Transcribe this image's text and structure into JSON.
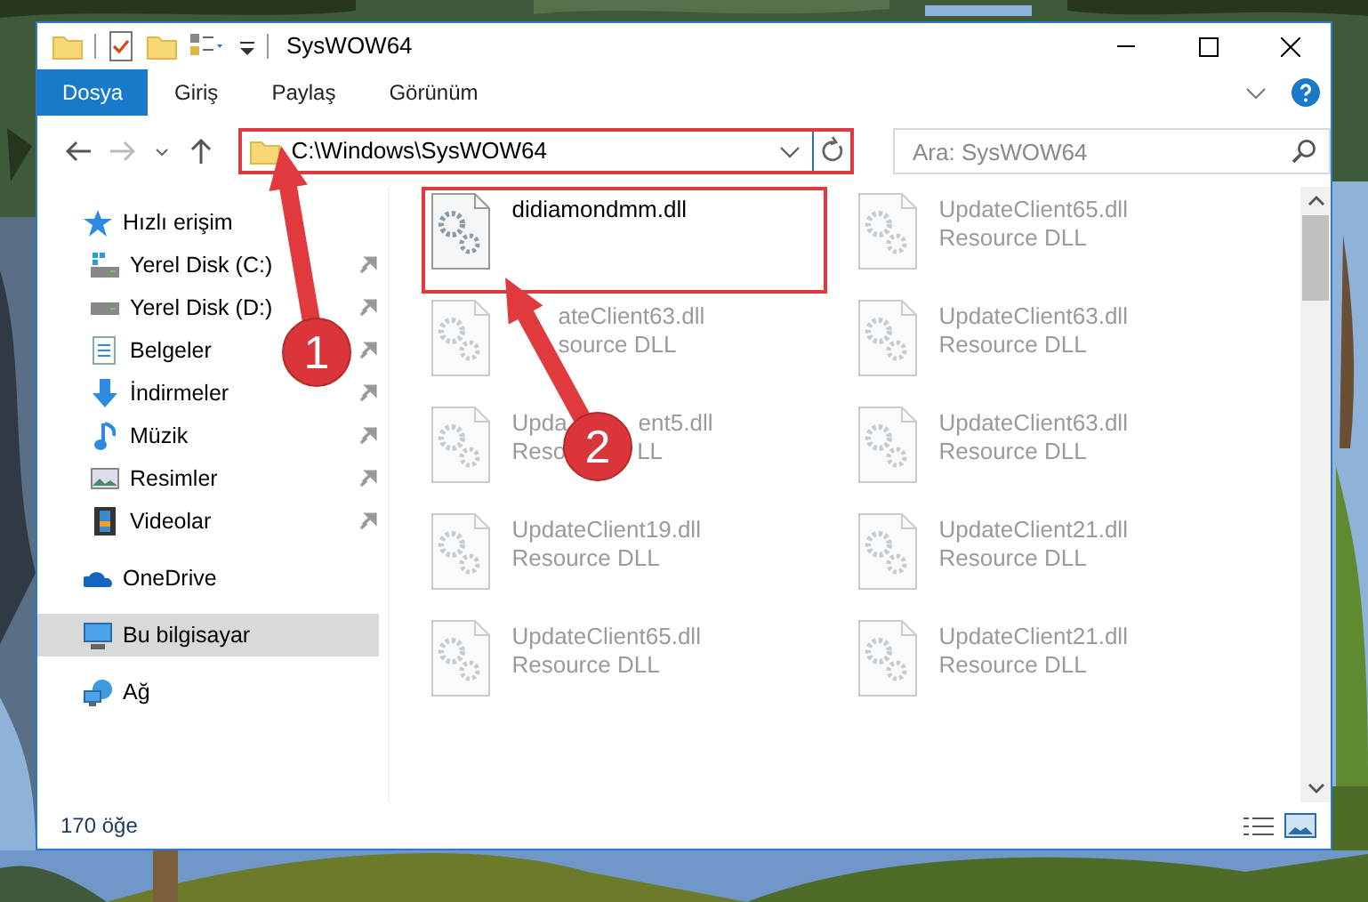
{
  "window": {
    "title": "SysWOW64"
  },
  "ribbon": {
    "tabs": [
      {
        "label": "Dosya",
        "kind": "file",
        "selected": false
      },
      {
        "label": "Giriş",
        "kind": "tab",
        "selected": false
      },
      {
        "label": "Paylaş",
        "kind": "tab",
        "selected": false
      },
      {
        "label": "Görünüm",
        "kind": "tab",
        "selected": false
      }
    ]
  },
  "address": {
    "path": "C:\\Windows\\SysWOW64",
    "highlighted": true
  },
  "search": {
    "placeholder": "Ara: SysWOW64"
  },
  "navigation": [
    {
      "label": "Hızlı erişim",
      "kind": "star",
      "selected": false,
      "children": [
        {
          "label": "Yerel Disk (C:)",
          "kind": "system-drive",
          "pinned": true,
          "selected": false
        },
        {
          "label": "Yerel Disk (D:)",
          "kind": "drive",
          "pinned": true,
          "selected": false
        },
        {
          "label": "Belgeler",
          "kind": "documents",
          "pinned": true,
          "selected": false
        },
        {
          "label": "İndirmeler",
          "kind": "download",
          "pinned": true,
          "selected": false
        },
        {
          "label": "Müzik",
          "kind": "music",
          "pinned": true,
          "selected": false
        },
        {
          "label": "Resimler",
          "kind": "pictures",
          "pinned": true,
          "selected": false
        },
        {
          "label": "Videolar",
          "kind": "video",
          "pinned": true,
          "selected": false
        }
      ]
    },
    {
      "label": "OneDrive",
      "kind": "cloud",
      "selected": false
    },
    {
      "label": "Bu bilgisayar",
      "kind": "computer",
      "selected": true
    },
    {
      "label": "Ağ",
      "kind": "network",
      "selected": false
    }
  ],
  "files": [
    {
      "name": [
        "didiamondmm.dll"
      ],
      "dimmed": false,
      "highlighted": true
    },
    {
      "name": [
        "UpdateClient65.dll"
      ],
      "type": [
        "Resource DLL"
      ],
      "dimmed": true,
      "highlighted": false
    },
    {
      "name": [
        "ateClient63.dll"
      ],
      "type": [
        "source DLL"
      ],
      "partly_covered": true,
      "dimmed": true,
      "highlighted": false
    },
    {
      "name": [
        "UpdateClient63.dll"
      ],
      "type": [
        "Resource DLL"
      ],
      "dimmed": true,
      "highlighted": false
    },
    {
      "name": [
        "Upda",
        "ent5.dll"
      ],
      "type": [
        "Reso",
        "LL"
      ],
      "partly_covered": true,
      "dimmed": true,
      "highlighted": false
    },
    {
      "name": [
        "UpdateClient63.dll"
      ],
      "type": [
        "Resource DLL"
      ],
      "dimmed": true,
      "highlighted": false
    },
    {
      "name": [
        "UpdateClient19.dll"
      ],
      "type": [
        "Resource DLL"
      ],
      "dimmed": true,
      "highlighted": false
    },
    {
      "name": [
        "UpdateClient21.dll"
      ],
      "type": [
        "Resource DLL"
      ],
      "dimmed": true,
      "highlighted": false
    },
    {
      "name": [
        "UpdateClient65.dll"
      ],
      "type": [
        "Resource DLL"
      ],
      "dimmed": true,
      "highlighted": false
    },
    {
      "name": [
        "UpdateClient21.dll"
      ],
      "type": [
        "Resource DLL"
      ],
      "dimmed": true,
      "highlighted": false
    }
  ],
  "status_bar": {
    "item_count": "170 öğe"
  },
  "annotations": [
    {
      "number": "1"
    },
    {
      "number": "2"
    }
  ]
}
